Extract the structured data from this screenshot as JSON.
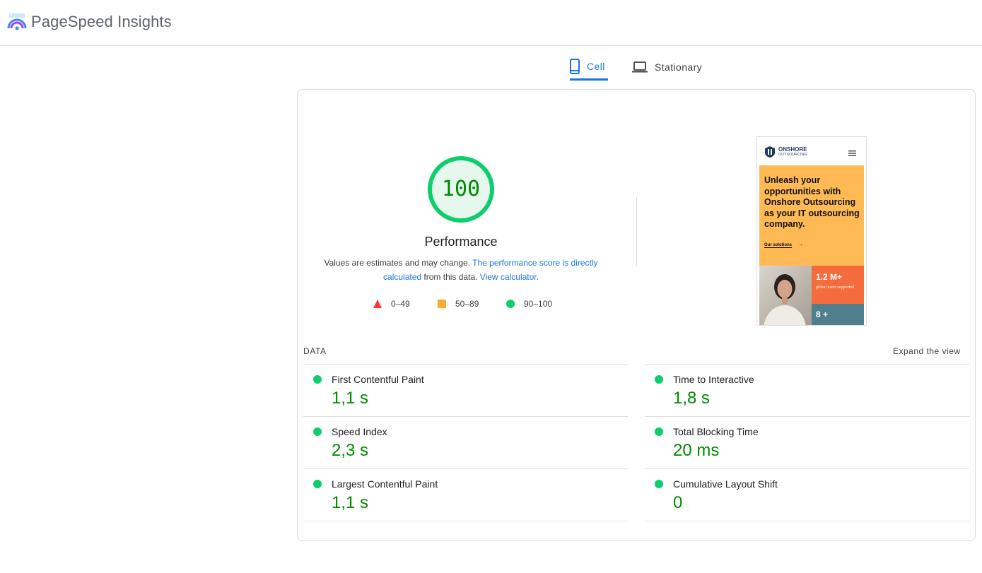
{
  "header": {
    "title": "PageSpeed Insights"
  },
  "tabs": [
    {
      "label": "Cell",
      "icon": "smartphone-icon",
      "active": true
    },
    {
      "label": "Stationary",
      "icon": "laptop-icon",
      "active": false
    }
  ],
  "performance": {
    "score": "100",
    "title": "Performance",
    "desc_prefix": "Values are estimates and may change.",
    "desc_link": "The performance score is directly calculated",
    "desc_middle": "from this data.",
    "desc_calc_link": "View calculator.",
    "legend": [
      {
        "range": "0–49",
        "shape": "triangle",
        "color": "#ff3333"
      },
      {
        "range": "50–89",
        "shape": "square",
        "color": "#ffaa33"
      },
      {
        "range": "90–100",
        "shape": "circle",
        "color": "#0cce6b"
      }
    ]
  },
  "screenshot": {
    "brand": "ONSHORE",
    "brand_sub": "OUTSOURCING",
    "headline": "Unleash your opportunities with Onshore Outsourcing as your IT outsourcing company.",
    "link": "Our solutions",
    "stat1_value": "1.2 M+",
    "stat1_caption": "global users supported",
    "stat2_value": "8 +"
  },
  "metrics": {
    "section_label": "DATA",
    "expand_label": "Expand the view",
    "items": [
      {
        "name": "First Contentful Paint",
        "value": "1,1 s"
      },
      {
        "name": "Time to Interactive",
        "value": "1,8 s"
      },
      {
        "name": "Speed Index",
        "value": "2,3 s"
      },
      {
        "name": "Total Blocking Time",
        "value": "20 ms"
      },
      {
        "name": "Largest Contentful Paint",
        "value": "1,1 s"
      },
      {
        "name": "Cumulative Layout Shift",
        "value": "0"
      }
    ]
  },
  "colors": {
    "accent": "#1a73e8",
    "pass": "#0cce6b",
    "pass_text": "#008800"
  }
}
